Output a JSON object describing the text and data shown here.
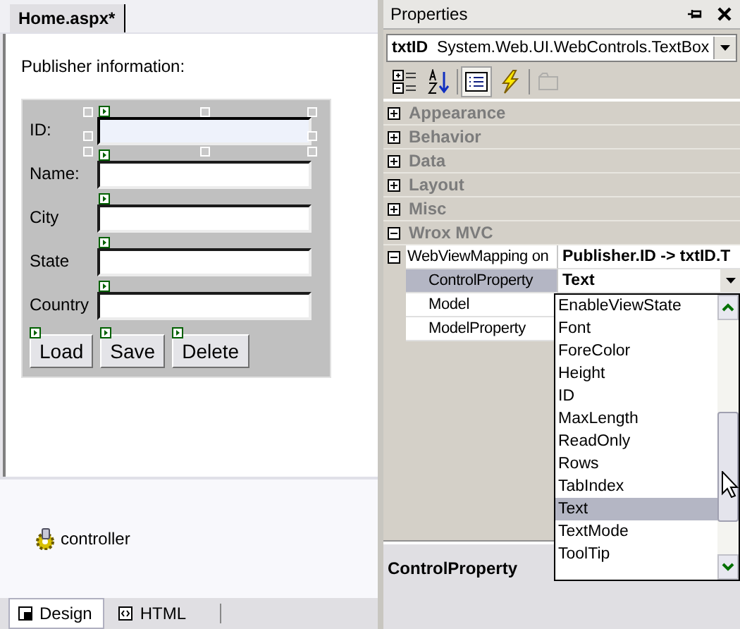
{
  "document_tab": {
    "title": "Home.aspx*"
  },
  "form": {
    "heading": "Publisher information:",
    "fields": [
      {
        "label": "ID:",
        "selected": true
      },
      {
        "label": "Name:",
        "selected": false
      },
      {
        "label": "City",
        "selected": false
      },
      {
        "label": "State",
        "selected": false
      },
      {
        "label": "Country",
        "selected": false
      }
    ],
    "buttons": [
      "Load",
      "Save",
      "Delete"
    ]
  },
  "component_tray": {
    "items": [
      "controller"
    ]
  },
  "view_tabs": [
    {
      "label": "Design",
      "kind": "design",
      "selected": true
    },
    {
      "label": "HTML",
      "kind": "html",
      "selected": false
    }
  ],
  "properties": {
    "title": "Properties",
    "object": {
      "name": "txtID",
      "type": "System.Web.UI.WebControls.TextBox"
    },
    "toolbar": [
      {
        "kind": "categorized",
        "selected": false,
        "disabled": false
      },
      {
        "kind": "alphabetical",
        "selected": false,
        "disabled": false
      },
      {
        "kind": "properties",
        "selected": true,
        "disabled": false
      },
      {
        "kind": "events",
        "selected": false,
        "disabled": false
      },
      {
        "kind": "pages",
        "selected": false,
        "disabled": true
      }
    ],
    "categories": [
      {
        "label": "Appearance",
        "expanded": false
      },
      {
        "label": "Behavior",
        "expanded": false
      },
      {
        "label": "Data",
        "expanded": false
      },
      {
        "label": "Layout",
        "expanded": false
      },
      {
        "label": "Misc",
        "expanded": false
      },
      {
        "label": "Wrox MVC",
        "expanded": true,
        "properties": [
          {
            "name": "WebViewMapping on",
            "value": "Publisher.ID -> txtID.T",
            "expanded": true,
            "children": [
              {
                "name": "ControlProperty",
                "value": "Text",
                "selected": true
              },
              {
                "name": "Model",
                "selected": false
              },
              {
                "name": "ModelProperty",
                "selected": false
              }
            ]
          }
        ]
      }
    ],
    "dropdown": {
      "items": [
        {
          "label": "EnableViewState",
          "selected": false
        },
        {
          "label": "Font",
          "selected": false
        },
        {
          "label": "ForeColor",
          "selected": false
        },
        {
          "label": "Height",
          "selected": false
        },
        {
          "label": "ID",
          "selected": false
        },
        {
          "label": "MaxLength",
          "selected": false
        },
        {
          "label": "ReadOnly",
          "selected": false
        },
        {
          "label": "Rows",
          "selected": false
        },
        {
          "label": "TabIndex",
          "selected": false
        },
        {
          "label": "Text",
          "selected": true
        },
        {
          "label": "TextMode",
          "selected": false
        },
        {
          "label": "ToolTip",
          "selected": false
        }
      ]
    },
    "description": {
      "title": "ControlProperty"
    }
  }
}
